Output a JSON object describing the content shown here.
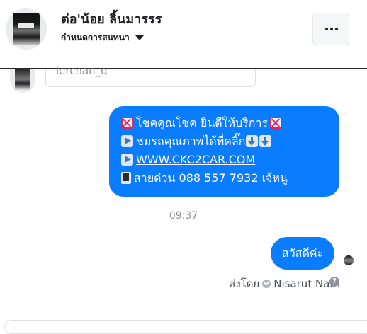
{
  "header": {
    "name": "ต่อ'น้อย ลิ้นมารรร",
    "subtitle": "กำหนดการสนทนา"
  },
  "previous": {
    "text": "lerchan_q"
  },
  "bubble": {
    "line1": "โชคคูณโชค ยินดีให้บริการ",
    "line2": "ชมรถคุณภาพได้ที่คลิ๊ก",
    "line3": "WWW.CKC2CAR.COM",
    "line4": "สายด่วน 088 557 7932 เจ้หนู"
  },
  "time": "09:37",
  "reply": {
    "text": "สวัสดีค่ะ"
  },
  "sent_by": {
    "prefix": "ส่งโดย",
    "name": "Nisarut Nam"
  },
  "icons": [
    "more-icon",
    "caret-down-icon",
    "cross-mark-icon",
    "play-button-icon",
    "down-arrow-icon",
    "phone-icon",
    "verified-check-icon",
    "help-icon"
  ]
}
